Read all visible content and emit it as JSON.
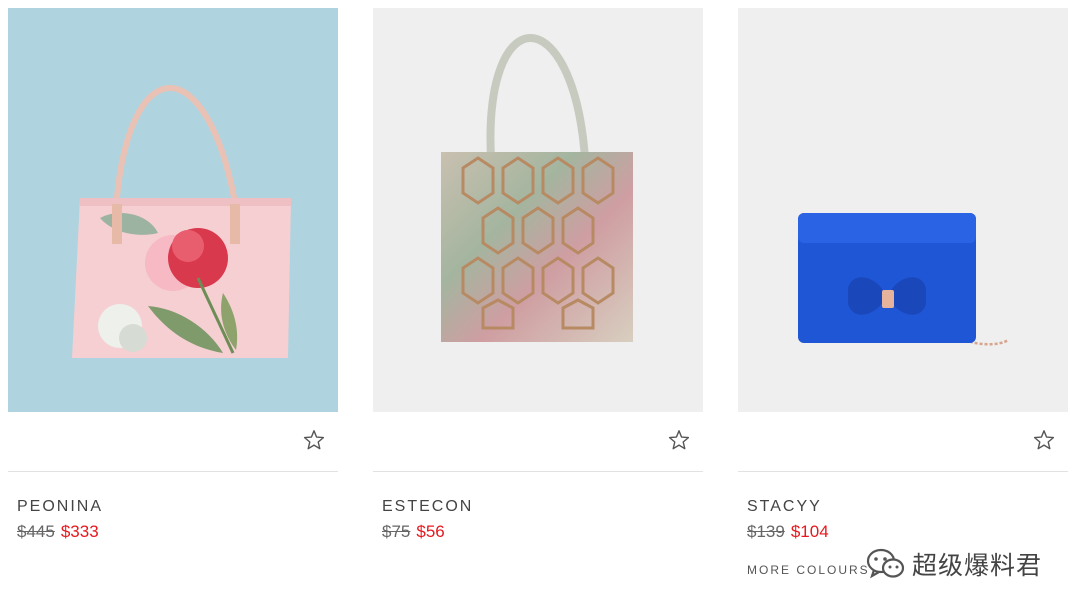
{
  "products": [
    {
      "name": "PEONINA",
      "old_price": "$445",
      "sale_price": "$333",
      "image_alt": "pink floral tote bag",
      "image_bg": "#afd3df"
    },
    {
      "name": "ESTECON",
      "old_price": "$75",
      "sale_price": "$56",
      "image_alt": "geometric print shopper bag",
      "image_bg": "#efefef"
    },
    {
      "name": "STACYY",
      "old_price": "$139",
      "sale_price": "$104",
      "image_alt": "blue bow cross-body bag",
      "image_bg": "#efefef",
      "more_colours": "MORE COLOURS"
    }
  ],
  "icons": {
    "wishlist": "star-outline-icon",
    "watermark_logo": "wechat-icon"
  },
  "colors": {
    "sale": "#e5191e",
    "divider": "#e2e2e2",
    "accent_blue": "#1f56d6"
  },
  "watermark": {
    "text": "超级爆料君"
  }
}
